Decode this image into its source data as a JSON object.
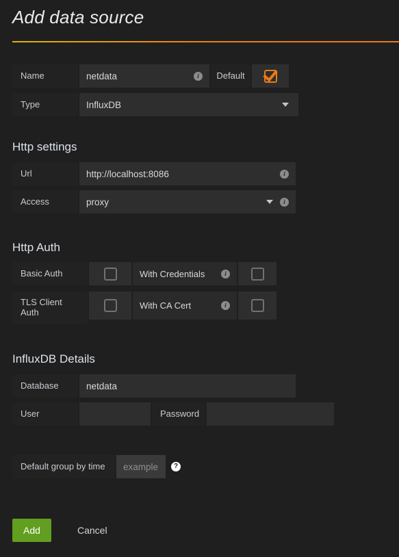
{
  "header": {
    "title": "Add data source"
  },
  "basic": {
    "name_label": "Name",
    "name_value": "netdata",
    "default_label": "Default",
    "default_checked": true,
    "type_label": "Type",
    "type_value": "InfluxDB"
  },
  "http_settings": {
    "section_title": "Http settings",
    "url_label": "Url",
    "url_value": "http://localhost:8086",
    "access_label": "Access",
    "access_value": "proxy"
  },
  "http_auth": {
    "section_title": "Http Auth",
    "basic_auth_label": "Basic Auth",
    "basic_auth_checked": false,
    "with_credentials_label": "With Credentials",
    "with_credentials_checked": false,
    "tls_client_auth_label": "TLS Client Auth",
    "tls_client_auth_checked": false,
    "with_ca_cert_label": "With CA Cert",
    "with_ca_cert_checked": false
  },
  "influxdb_details": {
    "section_title": "InfluxDB Details",
    "database_label": "Database",
    "database_value": "netdata",
    "user_label": "User",
    "user_value": "",
    "password_label": "Password",
    "password_value": ""
  },
  "group_by": {
    "label": "Default group by time",
    "placeholder": "example",
    "value": ""
  },
  "actions": {
    "add_label": "Add",
    "cancel_label": "Cancel"
  },
  "icons": {
    "info": "i",
    "help": "?"
  },
  "colors": {
    "background": "#1f1f20",
    "label_bg": "#222223",
    "field_bg": "#2e2e2e",
    "accent_orange": "#eb7b18",
    "accent_yellow": "#e0b400",
    "add_green": "#629e1f"
  }
}
